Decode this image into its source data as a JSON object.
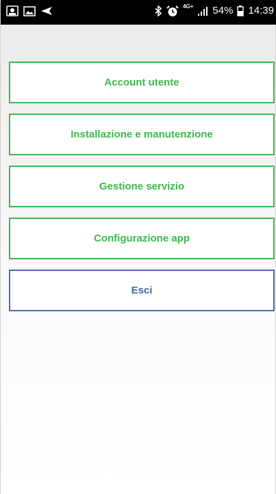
{
  "status_bar": {
    "battery_percent": "54%",
    "time": "14:39",
    "network_type": "4G+",
    "icons": [
      "photo-icon",
      "gallery-icon",
      "send-icon",
      "bluetooth-icon",
      "alarm-icon",
      "signal-icon",
      "battery-icon"
    ]
  },
  "menu": {
    "items": [
      {
        "label": "Account utente"
      },
      {
        "label": "Installazione e manutenzione"
      },
      {
        "label": "Gestione servizio"
      },
      {
        "label": "Configurazione app"
      }
    ],
    "exit_label": "Esci"
  },
  "colors": {
    "primary_green": "#3cb84a",
    "exit_blue": "#3f6ab5",
    "status_bar_bg": "#000000"
  }
}
